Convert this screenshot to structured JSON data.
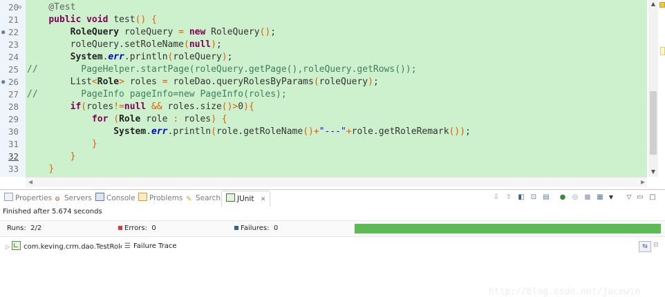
{
  "editor": {
    "lines": [
      {
        "num": "20",
        "marker": "",
        "fold": "⊖",
        "segs": [
          [
            "ann",
            "    @Test"
          ]
        ]
      },
      {
        "num": "21",
        "marker": "",
        "fold": "",
        "segs": [
          [
            "",
            "    "
          ],
          [
            "kw",
            "public"
          ],
          [
            "",
            " "
          ],
          [
            "kw",
            "void"
          ],
          [
            "",
            " test"
          ],
          [
            "op",
            "()"
          ],
          [
            "",
            " "
          ],
          [
            "op",
            "{"
          ]
        ]
      },
      {
        "num": "22",
        "marker": "●",
        "fold": "",
        "segs": [
          [
            "",
            "        "
          ],
          [
            "clsb",
            "RoleQuery"
          ],
          [
            "",
            " roleQuery "
          ],
          [
            "op",
            "="
          ],
          [
            "",
            " "
          ],
          [
            "kw",
            "new"
          ],
          [
            "",
            " "
          ],
          [
            "cls",
            "RoleQuery"
          ],
          [
            "op",
            "()"
          ],
          [
            "",
            ";"
          ]
        ]
      },
      {
        "num": "23",
        "marker": "",
        "fold": "",
        "segs": [
          [
            "",
            "        roleQuery.setRoleName"
          ],
          [
            "op",
            "("
          ],
          [
            "kw",
            "null"
          ],
          [
            "op",
            ")"
          ],
          [
            "",
            ";"
          ]
        ]
      },
      {
        "num": "24",
        "marker": "",
        "fold": "",
        "segs": [
          [
            "",
            "        "
          ],
          [
            "clsb",
            "System"
          ],
          [
            "",
            "."
          ],
          [
            "fld",
            "err"
          ],
          [
            "",
            ".println"
          ],
          [
            "op",
            "("
          ],
          [
            "",
            "roleQuery"
          ],
          [
            "op",
            ")"
          ],
          [
            "",
            ";"
          ]
        ]
      },
      {
        "num": "25",
        "marker": "",
        "fold": "",
        "segs": [
          [
            "cmt",
            "//        PageHelper.startPage(roleQuery.getPage(),roleQuery.getRows());"
          ]
        ],
        "outdent": true
      },
      {
        "num": "26",
        "marker": "●",
        "fold": "",
        "segs": [
          [
            "",
            "        List"
          ],
          [
            "op",
            "<"
          ],
          [
            "clsb",
            "Role"
          ],
          [
            "op",
            ">"
          ],
          [
            "",
            " roles "
          ],
          [
            "op",
            "="
          ],
          [
            "",
            " roleDao.queryRolesByParams"
          ],
          [
            "op",
            "("
          ],
          [
            "",
            "roleQuery"
          ],
          [
            "op",
            ")"
          ],
          [
            "",
            ";"
          ]
        ]
      },
      {
        "num": "27",
        "marker": "",
        "fold": "",
        "segs": [
          [
            "cmt",
            "//        PageInfo pageInfo=new PageInfo(roles);"
          ]
        ],
        "outdent": true
      },
      {
        "num": "28",
        "marker": "",
        "fold": "",
        "segs": [
          [
            "",
            "        "
          ],
          [
            "kw",
            "if"
          ],
          [
            "op",
            "("
          ],
          [
            "",
            "roles"
          ],
          [
            "op",
            "!="
          ],
          [
            "kw",
            "null"
          ],
          [
            "",
            " "
          ],
          [
            "op",
            "&&"
          ],
          [
            "",
            " roles.size"
          ],
          [
            "op",
            "()>"
          ],
          [
            "",
            "0"
          ],
          [
            "op",
            ")"
          ],
          [
            "op",
            "{"
          ]
        ]
      },
      {
        "num": "29",
        "marker": "",
        "fold": "",
        "segs": [
          [
            "",
            "            "
          ],
          [
            "kw",
            "for"
          ],
          [
            "",
            " "
          ],
          [
            "op",
            "("
          ],
          [
            "clsb",
            "Role"
          ],
          [
            "",
            " role "
          ],
          [
            "op",
            ":"
          ],
          [
            "",
            " roles"
          ],
          [
            "op",
            ")"
          ],
          [
            "",
            " "
          ],
          [
            "op",
            "{"
          ]
        ]
      },
      {
        "num": "30",
        "marker": "",
        "fold": "",
        "segs": [
          [
            "",
            "                "
          ],
          [
            "clsb",
            "System"
          ],
          [
            "",
            "."
          ],
          [
            "fld",
            "err"
          ],
          [
            "",
            ".println"
          ],
          [
            "op",
            "("
          ],
          [
            "",
            "role.getRoleName"
          ],
          [
            "op",
            "()+"
          ],
          [
            "str",
            "\"---\""
          ],
          [
            "op",
            "+"
          ],
          [
            "",
            "role.getRoleRemark"
          ],
          [
            "op",
            "())"
          ],
          [
            "",
            ";"
          ]
        ]
      },
      {
        "num": "31",
        "marker": "",
        "fold": "",
        "segs": [
          [
            "",
            "            "
          ],
          [
            "op",
            "}"
          ]
        ]
      },
      {
        "num": "32",
        "marker": "",
        "fold": "",
        "segs": [
          [
            "",
            "        "
          ],
          [
            "op",
            "}"
          ]
        ],
        "current": true
      },
      {
        "num": "33",
        "marker": "",
        "fold": "",
        "segs": [
          [
            "",
            "    "
          ],
          [
            "op",
            "}"
          ]
        ]
      }
    ]
  },
  "tabs": [
    {
      "label": "Properties",
      "icon": "properties-icon"
    },
    {
      "label": "Servers",
      "icon": "servers-icon"
    },
    {
      "label": "Console",
      "icon": "console-icon"
    },
    {
      "label": "Problems",
      "icon": "problems-icon"
    },
    {
      "label": "Search",
      "icon": "search-icon"
    },
    {
      "label": "JUnit",
      "icon": "junit-icon",
      "active": true,
      "close": "✕"
    }
  ],
  "junit": {
    "status": "Finished after 5.674 seconds",
    "runs_label": "Runs:",
    "runs_value": "2/2",
    "errors_label": "Errors:",
    "errors_value": "0",
    "failures_label": "Failures:",
    "failures_value": "0",
    "progress": 1.0,
    "progress_color": "#5dbb55",
    "error_color": "#d9363e",
    "failure_color": "#3a5f95",
    "tree_item": "com.keving.crm.dao.TestRoleDao",
    "failure_trace_label": "Failure Trace"
  },
  "watermark": "http://blog.csdn.net/jacewin"
}
